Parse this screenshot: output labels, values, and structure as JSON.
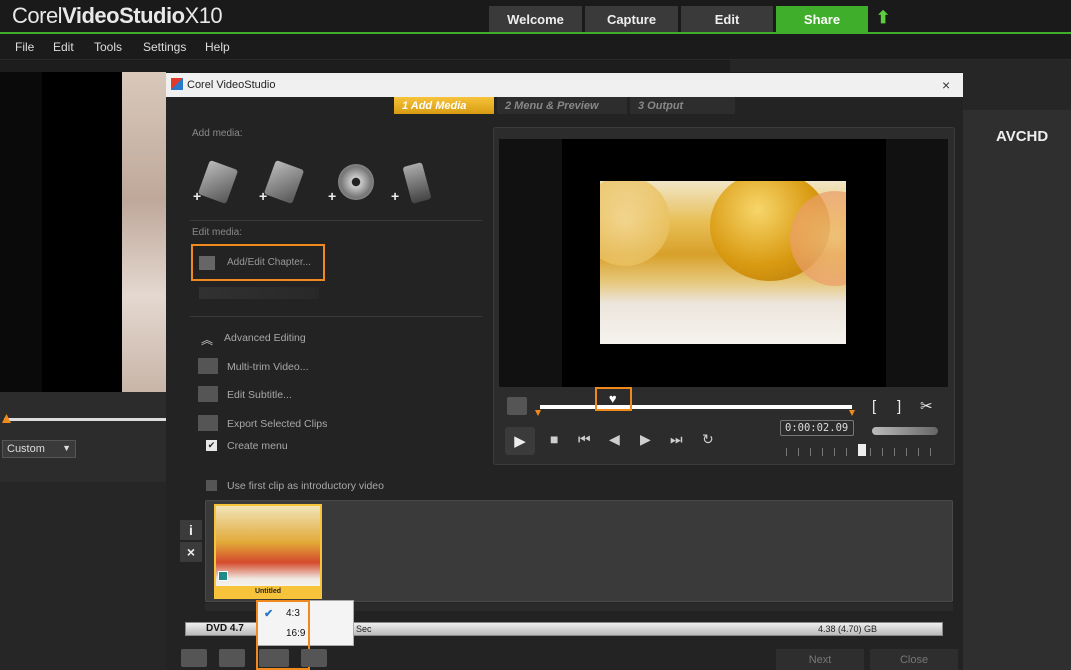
{
  "app": {
    "title_light": "Corel",
    "title_bold": "VideoStudio",
    "title_version": "X10"
  },
  "top_tabs": {
    "welcome": "Welcome",
    "capture": "Capture",
    "edit": "Edit",
    "share": "Share"
  },
  "menu": {
    "file": "File",
    "edit": "Edit",
    "tools": "Tools",
    "settings": "Settings",
    "help": "Help"
  },
  "left_panel": {
    "preset_select": "Custom"
  },
  "right_panel": {
    "format_label": "AVCHD"
  },
  "dialog": {
    "title": "Corel VideoStudio",
    "close_symbol": "×",
    "steps": [
      {
        "label": "1  Add Media",
        "active": true
      },
      {
        "label": "2  Menu & Preview",
        "active": false
      },
      {
        "label": "3  Output",
        "active": false
      }
    ],
    "add_media_label": "Add media:",
    "add_media_icons": [
      "add-video-icon",
      "add-vsp-project-icon",
      "add-disc-icon",
      "add-mobile-device-icon"
    ],
    "edit_media_label": "Edit media:",
    "add_edit_chapter": "Add/Edit Chapter...",
    "advanced_editing": "Advanced Editing",
    "multi_trim": "Multi-trim Video...",
    "edit_subtitle": "Edit Subtitle...",
    "export_selected": "Export Selected Clips",
    "create_menu": "Create menu",
    "create_menu_checked": true,
    "intro_video": "Use first clip as introductory video",
    "intro_video_checked": false
  },
  "player": {
    "mark_in": "[",
    "mark_out": "]",
    "timecode": "0:00:02.09",
    "play_icon": "play-icon",
    "progress_fraction": 0.24
  },
  "clip_strip": {
    "info_button": "i",
    "remove_button": "×",
    "clips": [
      {
        "label": "Untitled"
      }
    ]
  },
  "capacity": {
    "disc_label": "DVD 4.7",
    "duration_suffix": "Sec",
    "size": "4.38 (4.70) GB"
  },
  "aspect_popup": {
    "options": [
      "4:3",
      "16:9"
    ],
    "selected": "4:3",
    "check_symbol": "✔"
  },
  "footer": {
    "next": "Next",
    "close": "Close"
  },
  "colors": {
    "accent_green": "#3fae2a",
    "highlight_orange": "#f08a1c",
    "step_active": "#f7c33a"
  }
}
